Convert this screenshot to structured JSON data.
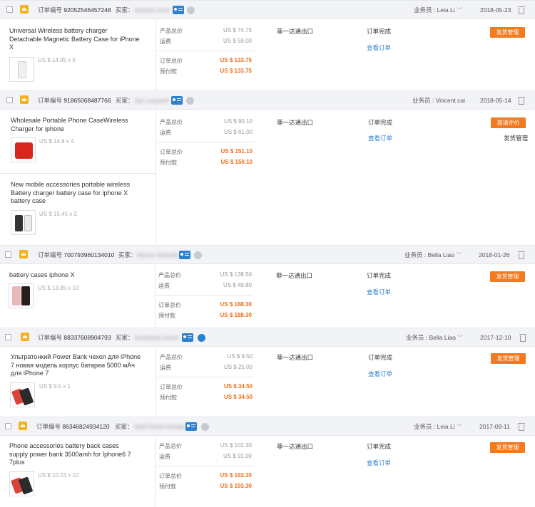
{
  "labels": {
    "order_no": "订单编号",
    "buyer": "买家：",
    "rep": "业务员 :",
    "product_total": "产品总价",
    "shipping": "运费",
    "order_total": "订单总价",
    "prepay": "预付款",
    "ship_method": "菲一达通出口",
    "status_done": "订单完成",
    "view_order": "查看订单",
    "ship_manage": "发货管理",
    "request_review": "邀请评价"
  },
  "orders": [
    {
      "order_number": "92052546457248",
      "buyer": "Andrew chen",
      "rep": "Leia Li",
      "date": "2018-05-23",
      "products": [
        {
          "title_lines": [
            "Universal Wireless battery charger",
            "Detachable Magnetic Battery Case for iPhone",
            "X"
          ],
          "price_qty": "US $ 14.95 x 5"
        }
      ],
      "product_total": "US $ 74.75",
      "shipping": "US $ 59.00",
      "order_total": "US $ 133.75",
      "prepay": "US $ 133.75",
      "status": "订单完成",
      "view": "查看订单",
      "button": "发货管理"
    },
    {
      "order_number": "91865068487766",
      "buyer": "Jay Leopardi",
      "rep": "Vincent cai",
      "date": "2018-05-14",
      "products": [
        {
          "title_lines": [
            "Wholesale Portable Phone CaseWireless",
            "Charger for iphone"
          ],
          "price_qty": "US $ 14.8 x 4"
        },
        {
          "title_lines": [
            "New mobile accessories portable wireless",
            "Battery charger battery case for iphone X",
            "battery case"
          ],
          "price_qty": "US $ 15.45 x 2"
        }
      ],
      "product_total": "US $ 90.10",
      "shipping": "US $ 61.00",
      "order_total": "US $ 151.10",
      "prepay": "US $ 150.10",
      "status": "订单完成",
      "view": "查看订单",
      "button": "邀请评价",
      "button_sub": "发货管理"
    },
    {
      "order_number": "700793960134010",
      "buyer": "Marcin Wolodev",
      "rep": "Bella Liao",
      "date": "2018-01-26",
      "products": [
        {
          "title_lines": [
            "battery cases iphone X"
          ],
          "price_qty": "US $ 13.85 x 10"
        }
      ],
      "product_total": "US $ 138.50",
      "shipping": "US $ 49.80",
      "order_total": "US $ 188.30",
      "prepay": "US $ 188.30",
      "status": "订单完成",
      "view": "查看订单",
      "button": "发货管理"
    },
    {
      "order_number": "88337608904793",
      "buyer": "Anastasia Green",
      "rep": "Bella Liao",
      "date": "2017-12-10",
      "products": [
        {
          "title_lines": [
            "Ультратонкий Power Bank чехол для iPhone",
            "7 новая модель корпус батареи 5000 мАч",
            "для iPhone 7"
          ],
          "price_qty": "US $ 9.5 x 1"
        }
      ],
      "product_total": "US $ 9.50",
      "shipping": "US $ 25.00",
      "order_total": "US $ 34.50",
      "prepay": "US $ 34.50",
      "status": "订单完成",
      "view": "查看订单",
      "button": "发货管理"
    },
    {
      "order_number": "86346824934120",
      "buyer": "Nad Fahed Alzaabi",
      "rep": "Leia Li",
      "date": "2017-09-11",
      "products": [
        {
          "title_lines": [
            "Phone accessories battery back cases",
            "supply power bank 3500amh for Iphone6 7",
            "7plus"
          ],
          "price_qty": "US $ 10.23 x 10"
        }
      ],
      "product_total": "US $ 102.30",
      "shipping": "US $ 91.00",
      "order_total": "US $ 193.30",
      "prepay": "US $ 193.30",
      "status": "订单完成",
      "view": "查看订单",
      "button": "发货管理"
    }
  ]
}
